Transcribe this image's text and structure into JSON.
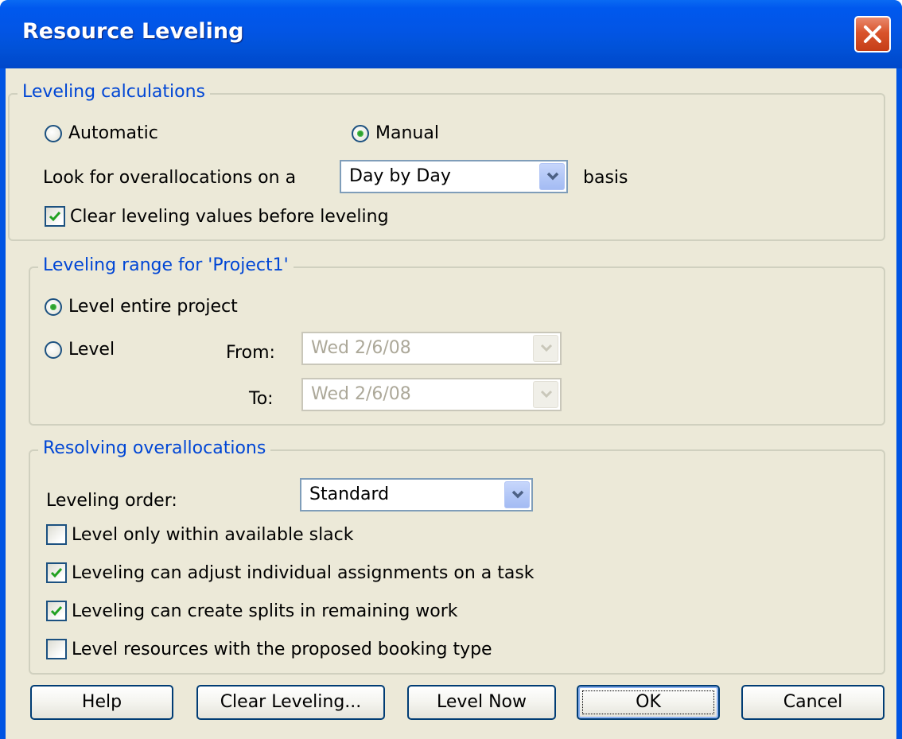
{
  "window": {
    "title": "Resource Leveling"
  },
  "leveling_calculations": {
    "legend": "Leveling calculations",
    "automatic_label": "Automatic",
    "manual_label": "Manual",
    "selected_mode": "Manual",
    "look_for_label": "Look for overallocations on a",
    "basis_value": "Day by Day",
    "basis_label": "basis",
    "clear_values_label": "Clear leveling values before leveling",
    "clear_values_checked": true
  },
  "leveling_range": {
    "legend": "Leveling range for 'Project1'",
    "entire_project_label": "Level entire project",
    "level_label": "Level",
    "selected": "Level entire project",
    "from_label": "From:",
    "from_value": "Wed 2/6/08",
    "to_label": "To:",
    "to_value": "Wed 2/6/08"
  },
  "resolving": {
    "legend": "Resolving overallocations",
    "order_label": "Leveling order:",
    "order_value": "Standard",
    "options": [
      {
        "label": "Level only within available slack",
        "checked": false
      },
      {
        "label": "Leveling can adjust individual assignments on a task",
        "checked": true
      },
      {
        "label": "Leveling can create splits in remaining work",
        "checked": true
      },
      {
        "label": "Level resources with the proposed booking type",
        "checked": false
      }
    ]
  },
  "buttons": {
    "help": "Help",
    "clear_leveling": "Clear Leveling...",
    "level_now": "Level Now",
    "ok": "OK",
    "cancel": "Cancel"
  },
  "colors": {
    "title_bar": "#0054e3",
    "dialog_bg": "#ece9d8",
    "group_label": "#0046d5",
    "close_button": "#d9542c"
  },
  "icons": {
    "close": "close-x-icon",
    "dropdown": "chevron-down-icon",
    "check": "checkmark-icon"
  }
}
